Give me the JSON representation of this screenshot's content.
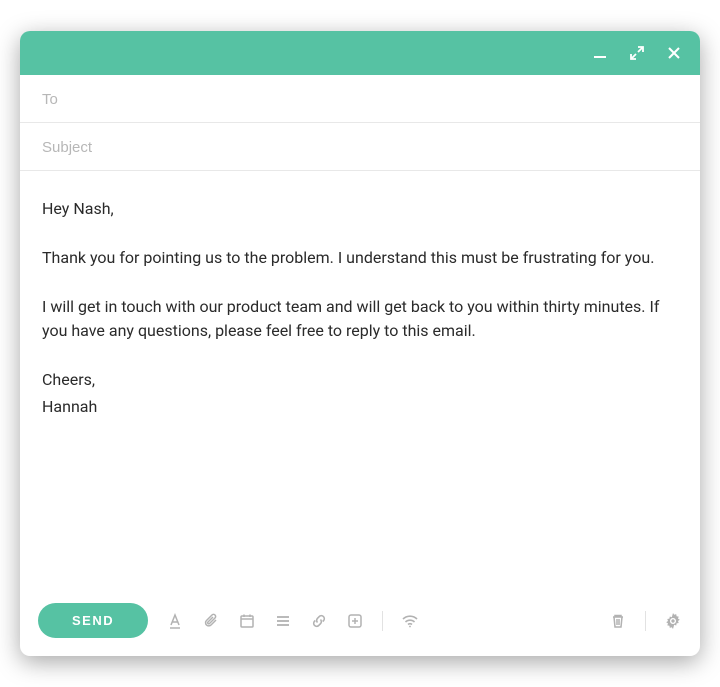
{
  "colors": {
    "accent": "#56c2a3"
  },
  "header": {
    "to_placeholder": "To",
    "to_value": "",
    "subject_placeholder": "Subject",
    "subject_value": ""
  },
  "body": {
    "greeting": "Hey Nash,",
    "p1": "Thank you for pointing us to the problem. I understand this must be frustrating for you.",
    "p2": "I will get in touch with our product team and will get back to you within thirty minutes. If you have any questions, please feel free to reply to this email.",
    "closing": "Cheers,",
    "signature": "Hannah"
  },
  "toolbar": {
    "send_label": "SEND"
  }
}
